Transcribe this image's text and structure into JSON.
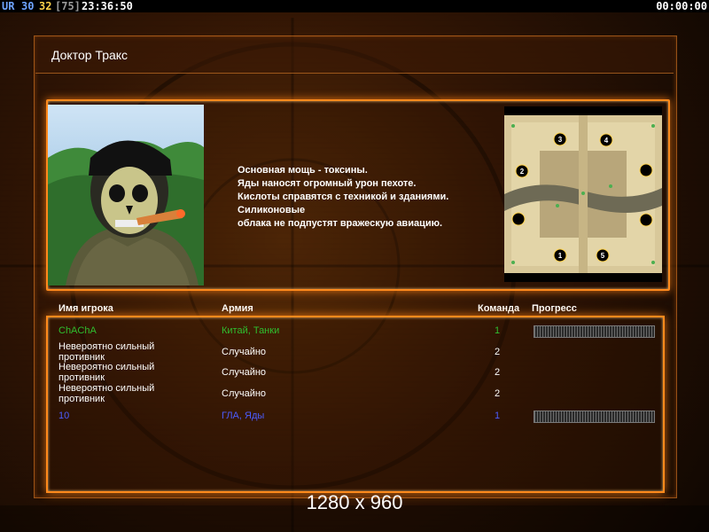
{
  "status_bar": {
    "ur": "UR",
    "v1": "30",
    "v2": "32",
    "v3": "[75]",
    "time": "23:36:50",
    "timer": "00:00:00"
  },
  "title": "Доктор Тракс",
  "description": [
    "Основная мощь - токсины.",
    "Яды наносят огромный урон пехоте.",
    "Кислоты справятся с техникой и зданиями.",
    "Силиконовые",
    "облака не подпустят вражескую авиацию."
  ],
  "columns": {
    "name": "Имя игрока",
    "army": "Армия",
    "team": "Команда",
    "progress": "Прогресс"
  },
  "players": [
    {
      "name": "ChAChA",
      "army": "Китай, Танки",
      "team": "1",
      "color": "#2fbf2f",
      "progress": 1.0
    },
    {
      "name": "Невероятно сильный противник",
      "army": "Случайно",
      "team": "2",
      "color": "#ffffff"
    },
    {
      "name": "Невероятно сильный противник",
      "army": "Случайно",
      "team": "2",
      "color": "#ffffff"
    },
    {
      "name": "Невероятно сильный противник",
      "army": "Случайно",
      "team": "2",
      "color": "#ffffff"
    },
    {
      "name": "10",
      "army": "ГЛА, Яды",
      "team": "1",
      "color": "#4b5cff",
      "progress": 1.0
    }
  ],
  "map_slots": [
    "3",
    "4",
    "2",
    "1",
    "5"
  ],
  "resolution": "1280 x 960",
  "colors": {
    "accent": "#ff8a1c"
  }
}
